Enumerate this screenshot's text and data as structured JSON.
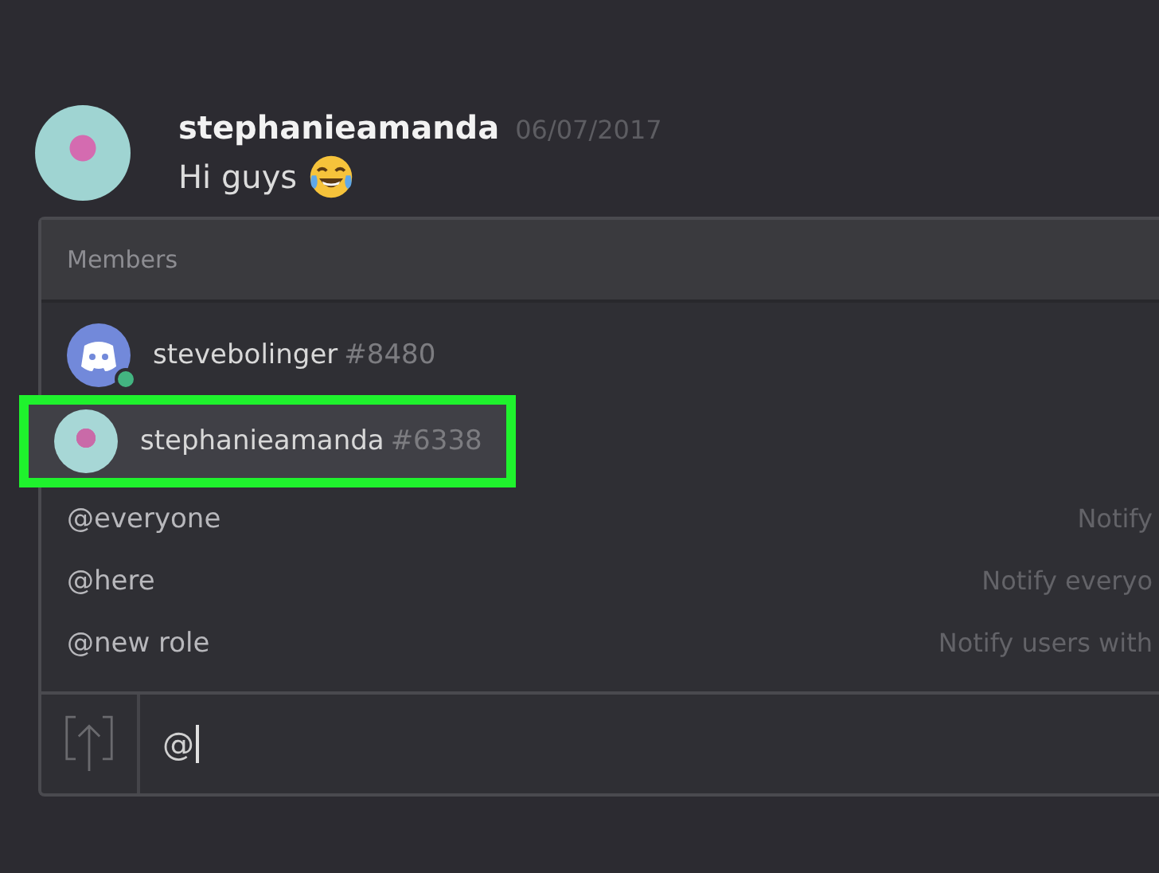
{
  "message": {
    "author": "stephanieamanda",
    "timestamp": "06/07/2017",
    "text": "Hi guys"
  },
  "popup": {
    "header": "Members",
    "members": [
      {
        "name": "stevebolinger",
        "tag": "#8480",
        "kind": "discord",
        "online": true,
        "selected": false
      },
      {
        "name": "stephanieamanda",
        "tag": "#6338",
        "kind": "photo",
        "online": false,
        "selected": true
      }
    ],
    "roles": [
      {
        "name": "@everyone",
        "description": "Notify"
      },
      {
        "name": "@here",
        "description": "Notify everyo"
      },
      {
        "name": "@new role",
        "description": "Notify users with"
      }
    ]
  },
  "composer": {
    "value": "@"
  }
}
